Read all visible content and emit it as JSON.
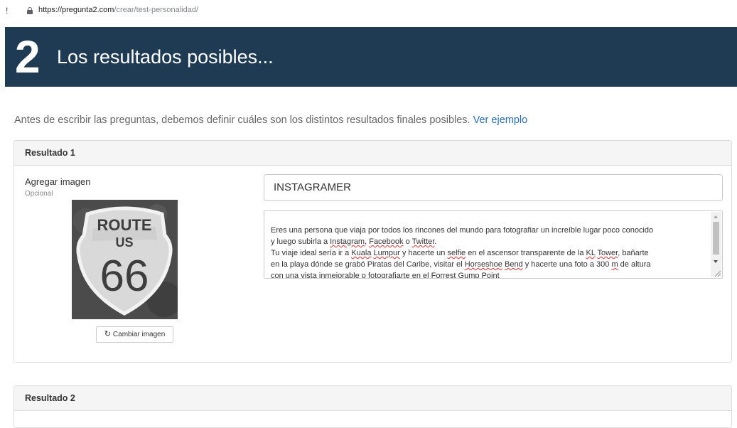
{
  "browser": {
    "indicator": "!",
    "url_host": "https://pregunta2.com",
    "url_path": "/crear/test-personalidad/"
  },
  "banner": {
    "step_number": "2",
    "title": "Los resultados posibles..."
  },
  "intro": {
    "text": "Antes de escribir las preguntas, debemos definir cuáles son los distintos resultados finales posibles.",
    "link": "Ver ejemplo"
  },
  "results": [
    {
      "header": "Resultado 1",
      "image_label": "Agregar imagen",
      "image_hint": "Opcional",
      "image_text": {
        "line1": "ROUTE",
        "line2": "US",
        "line3": "66"
      },
      "change_image_label": "Cambiar imagen",
      "name_value": "INSTAGRAMER",
      "description_segments": [
        {
          "t": "Eres una persona que viaja por todos los rincones del mundo para fotografiar un increíble lugar poco conocido\ny luego subirla a "
        },
        {
          "t": "Instagram",
          "sp": true
        },
        {
          "t": ", "
        },
        {
          "t": "Facebook",
          "sp": true
        },
        {
          "t": " o "
        },
        {
          "t": "Twitter",
          "sp": true
        },
        {
          "t": ".\nTu viaje ideal sería  ir a "
        },
        {
          "t": "Kuala",
          "sp": true
        },
        {
          "t": " "
        },
        {
          "t": "Lumpur",
          "sp": true
        },
        {
          "t": " y hacerte un "
        },
        {
          "t": "selfie",
          "sp": true
        },
        {
          "t": " en el ascensor transparente de la "
        },
        {
          "t": "KL",
          "sp": true
        },
        {
          "t": " "
        },
        {
          "t": "Tower",
          "sp": true
        },
        {
          "t": ", bañarte\nen la playa dónde se grabó Piratas del Caribe,  visitar el "
        },
        {
          "t": "Horseshoe",
          "sp": true
        },
        {
          "t": " "
        },
        {
          "t": "Bend",
          "sp": true
        },
        {
          "t": " y hacerte una foto a 300 "
        },
        {
          "t": "m",
          "sp": true
        },
        {
          "t": " de altura\ncon una vista inmejorable o fotografiarte en el "
        },
        {
          "t": "Forrest",
          "sp": true
        },
        {
          "t": " "
        },
        {
          "t": "Gump",
          "sp": true
        },
        {
          "t": " "
        },
        {
          "t": "Point",
          "sp": true
        }
      ]
    },
    {
      "header": "Resultado 2"
    }
  ]
}
